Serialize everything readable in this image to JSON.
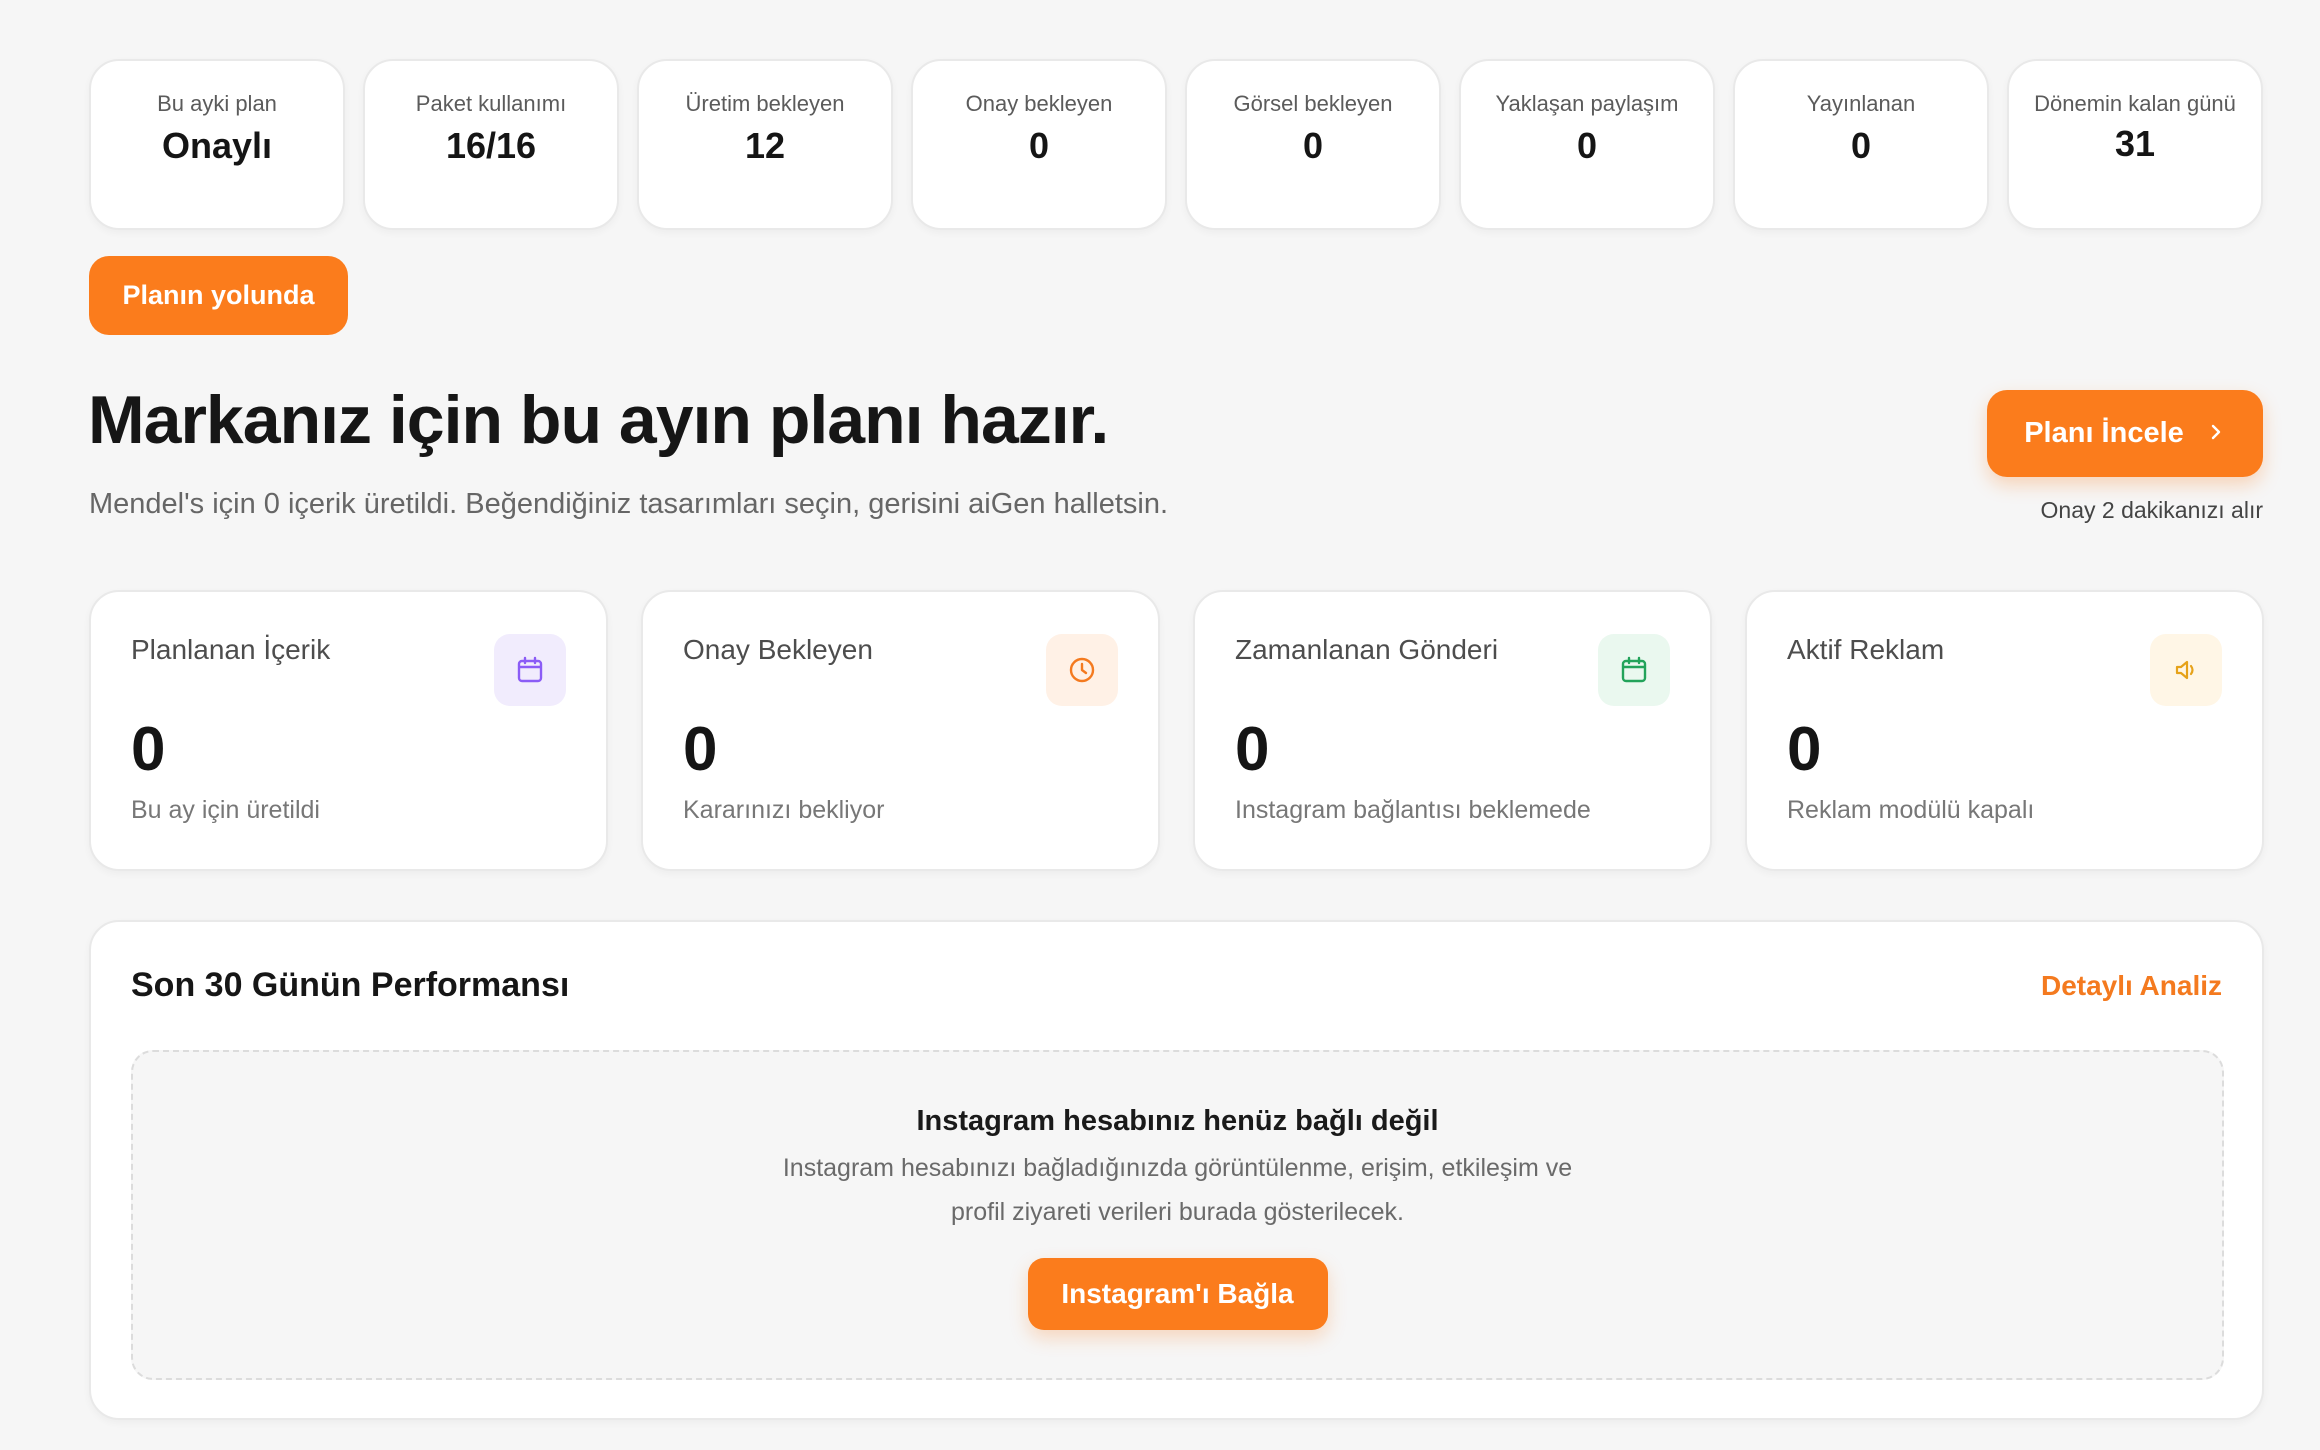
{
  "stats": [
    {
      "label": "Bu ayki plan",
      "value": "Onaylı"
    },
    {
      "label": "Paket kullanımı",
      "value": "16/16"
    },
    {
      "label": "Üretim bekleyen",
      "value": "12"
    },
    {
      "label": "Onay bekleyen",
      "value": "0"
    },
    {
      "label": "Görsel bekleyen",
      "value": "0"
    },
    {
      "label": "Yaklaşan paylaşım",
      "value": "0"
    },
    {
      "label": "Yayınlanan",
      "value": "0"
    },
    {
      "label": "Dönemin kalan günü",
      "value": "31"
    }
  ],
  "badge": {
    "label": "Planın yolunda",
    "color": "#fb7c1c"
  },
  "hero": {
    "title": "Markanız için bu ayın planı hazır.",
    "subtitle": "Mendel's için 0 içerik üretildi. Beğendiğiniz tasarımları seçin, gerisini aiGen halletsin.",
    "cta_label": "Planı İncele",
    "cta_icon": "chevron-right-icon",
    "cta_note": "Onay 2 dakikanızı alır"
  },
  "cards": [
    {
      "title": "Planlanan İçerik",
      "value": "0",
      "footnote": "Bu ay için üretildi",
      "icon": "calendar-icon",
      "icon_color": "#8b5cf6",
      "icon_bg": "#f1ecfd"
    },
    {
      "title": "Onay Bekleyen",
      "value": "0",
      "footnote": "Kararınızı bekliyor",
      "icon": "clock-icon",
      "icon_color": "#f47a1f",
      "icon_bg": "#fff1e6"
    },
    {
      "title": "Zamanlanan Gönderi",
      "value": "0",
      "footnote": "Instagram bağlantısı beklemede",
      "icon": "calendar-icon",
      "icon_color": "#22a35a",
      "icon_bg": "#eaf8ef"
    },
    {
      "title": "Aktif Reklam",
      "value": "0",
      "footnote": "Reklam modülü kapalı",
      "icon": "megaphone-icon",
      "icon_color": "#e6a21a",
      "icon_bg": "#fff6e6"
    }
  ],
  "performance": {
    "title": "Son 30 Günün Performansı",
    "link_label": "Detaylı Analiz",
    "empty_title": "Instagram hesabınız henüz bağlı değil",
    "empty_desc_line1": "Instagram hesabınızı bağladığınızda görüntülenme, erişim, etkileşim ve",
    "empty_desc_line2": "profil ziyareti verileri burada gösterilecek.",
    "connect_label": "Instagram'ı Bağla"
  },
  "colors": {
    "accent": "#fb7c1c",
    "link": "#f47a1f",
    "background": "#f6f6f6"
  }
}
